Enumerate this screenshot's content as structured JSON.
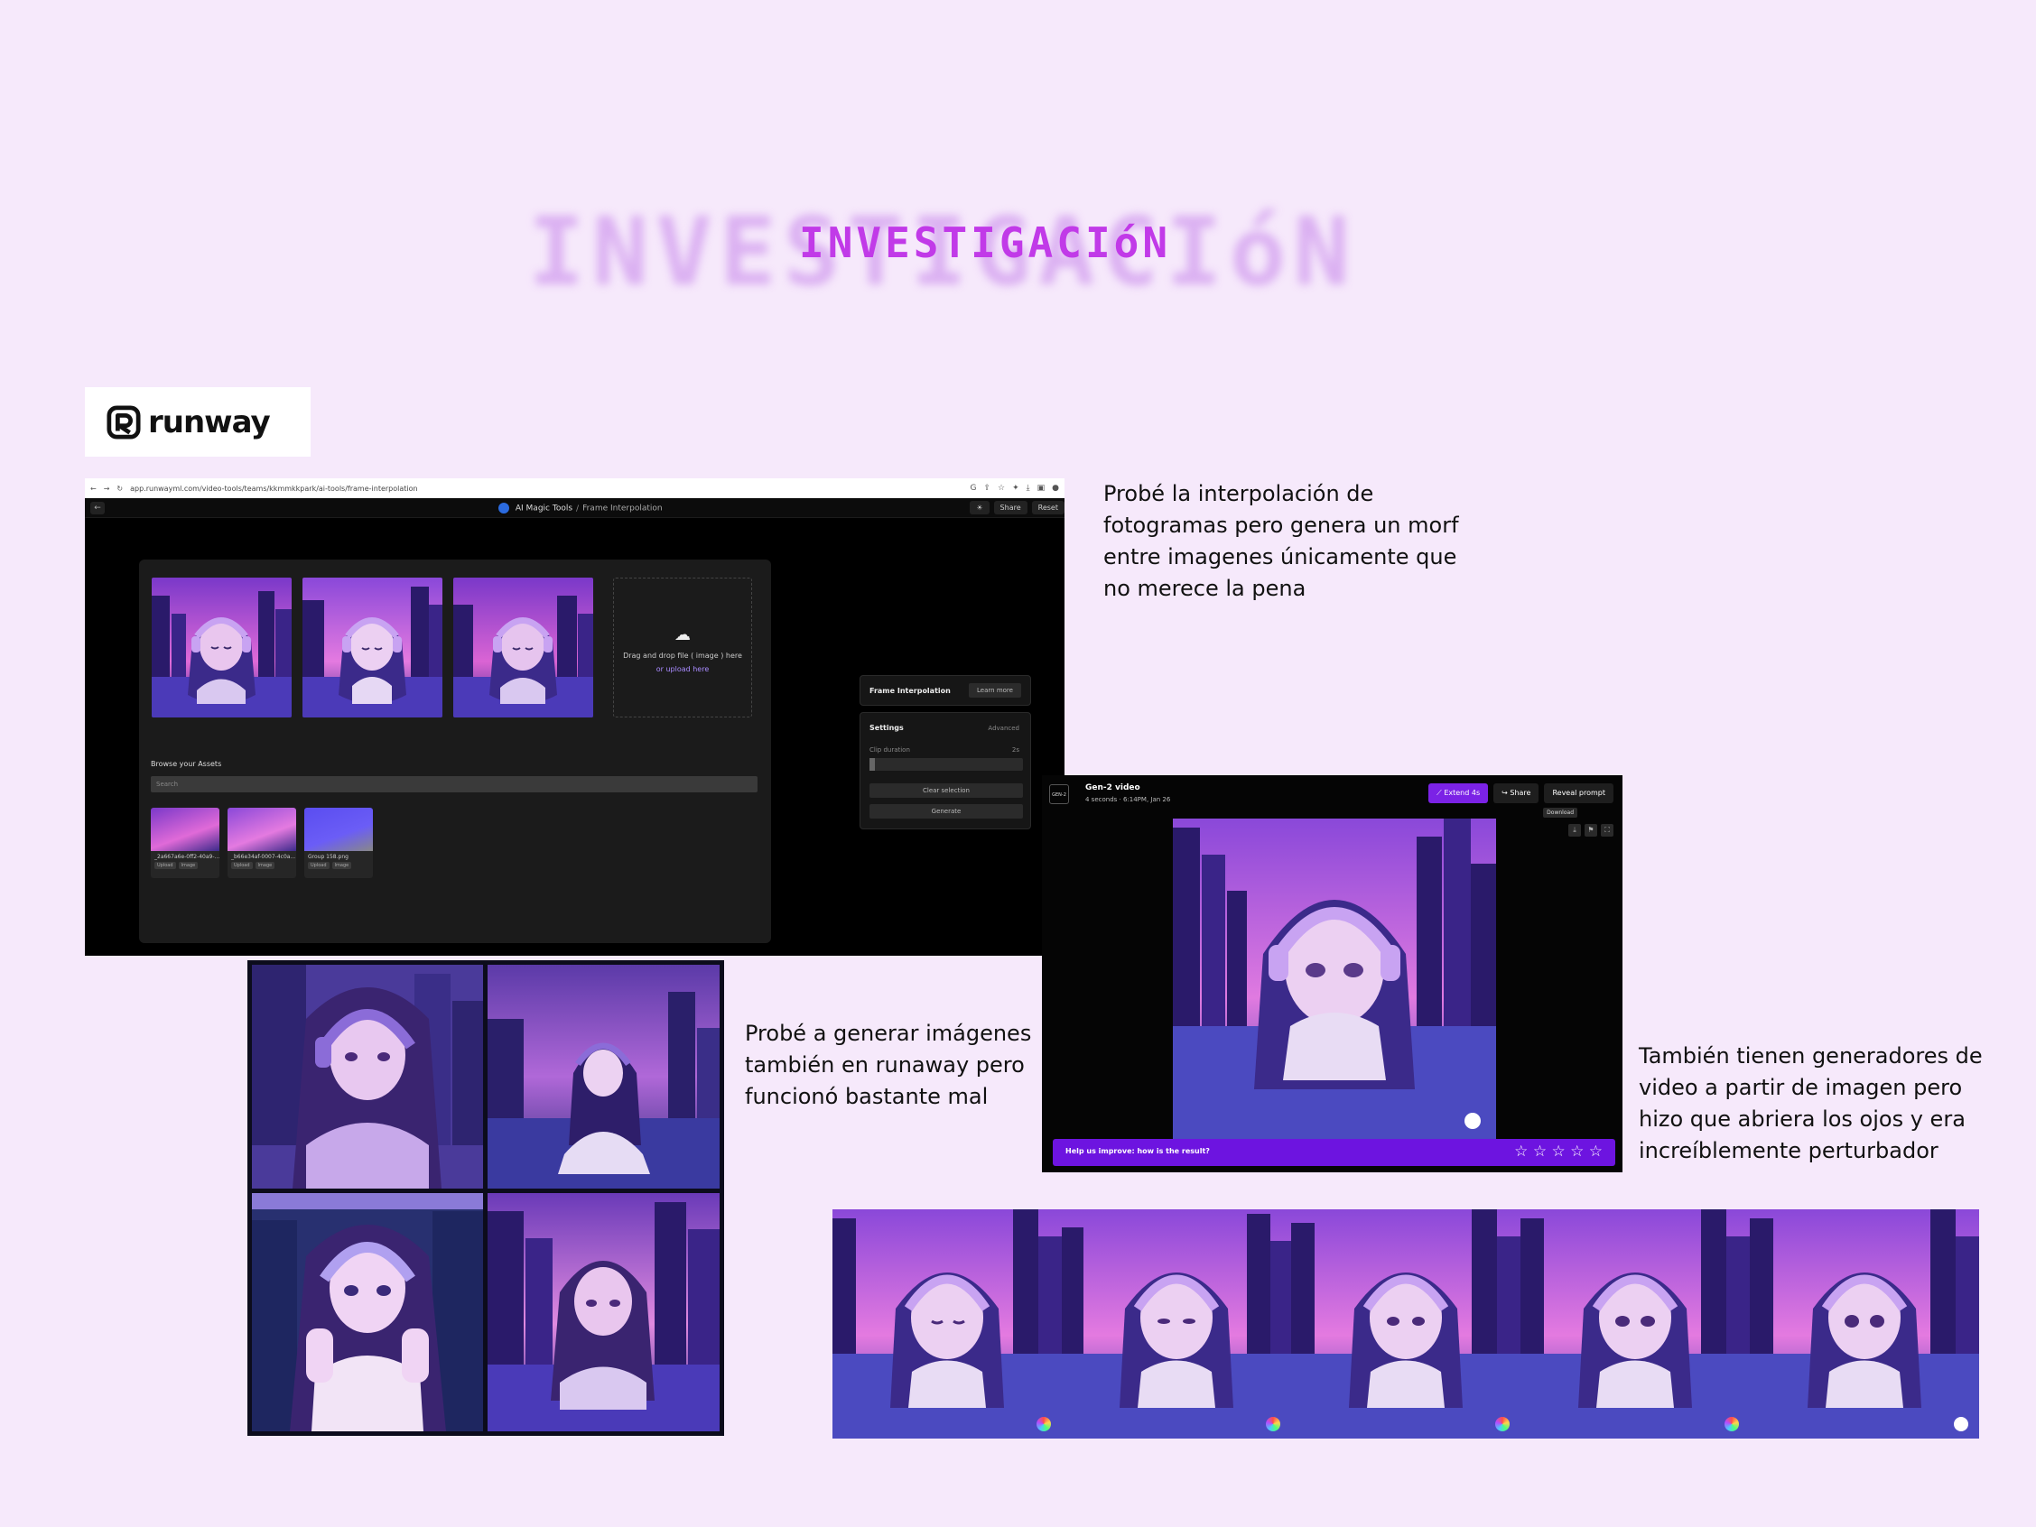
{
  "title": "INVESTIGACIóN",
  "logo": {
    "text": "runway"
  },
  "captions": {
    "interpolation": [
      "Probé la interpolación de",
      "fotogramas pero genera un morf",
      "entre imagenes únicamente que",
      "no merece la pena"
    ],
    "images": [
      "Probé a generar imágenes",
      "también en runaway pero",
      "funcionó bastante mal"
    ],
    "video": [
      "También tienen generadores de",
      "video a partir de imagen pero",
      "hizo que abriera los ojos y era",
      "increíblemente perturbador"
    ]
  },
  "interp_screen": {
    "url": "app.runwayml.com/video-tools/teams/kkmmkkpark/ai-tools/frame-interpolation",
    "breadcrumb_main": "AI Magic Tools",
    "breadcrumb_sub": "Frame Interpolation",
    "share_label": "Share",
    "reset_label": "Reset",
    "drop_text": "Drag and drop file ( image ) here",
    "drop_or": "or upload here",
    "browse_label": "Browse your Assets",
    "search_placeholder": "Search",
    "assets": [
      {
        "name": "_2a667a6e-0ff2-40a9-...",
        "tag1": "Upload",
        "tag2": "Image"
      },
      {
        "name": "_b66e34af-0007-4c0a...",
        "tag1": "Upload",
        "tag2": "Image"
      },
      {
        "name": "Group 158.png",
        "tag1": "Upload",
        "tag2": "Image"
      }
    ],
    "side_title": "Frame Interpolation",
    "learn_more": "Learn more",
    "settings_label": "Settings",
    "advanced_label": "Advanced",
    "clip_duration_label": "Clip duration",
    "clip_duration_value": "2s",
    "clear_selection": "Clear selection",
    "generate": "Generate"
  },
  "gen2_screen": {
    "logo": "GEN-2",
    "title": "Gen-2 video",
    "subtitle": "4 seconds · 6:14PM, Jan 26",
    "extend": "Extend 4s",
    "share": "Share",
    "reveal": "Reveal prompt",
    "tooltip": "Download",
    "feedback": "Help us improve: how is the result?",
    "stars": "☆ ☆ ☆ ☆ ☆"
  },
  "colors": {
    "background": "#f6e9fb",
    "title": "#c13ae8",
    "accent_purple": "#7b22e6"
  }
}
